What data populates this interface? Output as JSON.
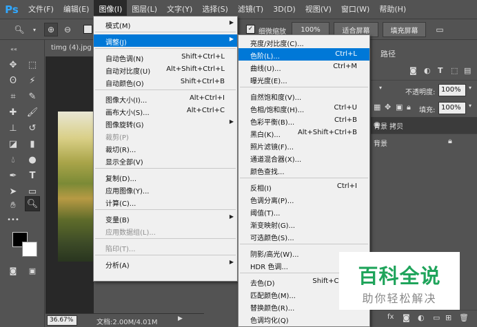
{
  "app": {
    "logo": "Ps"
  },
  "menubar": [
    "文件(F)",
    "编辑(E)",
    "图像(I)",
    "图层(L)",
    "文字(Y)",
    "选择(S)",
    "滤镜(T)",
    "3D(D)",
    "视图(V)",
    "窗口(W)",
    "帮助(H)"
  ],
  "options": {
    "resize_windows_label": "细微缩放",
    "zoom_value": "100%",
    "fit_screen": "适合屏幕",
    "fill_screen": "填充屏幕"
  },
  "document": {
    "tab": "timg (4).jpg",
    "zoom": "36.67%",
    "doc_info": "文档:2.00M/4.01M"
  },
  "image_menu": [
    {
      "label": "模式(M)",
      "submenu": true
    },
    {
      "sep": true
    },
    {
      "label": "调整(J)",
      "submenu": true,
      "highlight": true
    },
    {
      "sep": true
    },
    {
      "label": "自动色调(N)",
      "shortcut": "Shift+Ctrl+L"
    },
    {
      "label": "自动对比度(U)",
      "shortcut": "Alt+Shift+Ctrl+L"
    },
    {
      "label": "自动颜色(O)",
      "shortcut": "Shift+Ctrl+B"
    },
    {
      "sep": true
    },
    {
      "label": "图像大小(I)...",
      "shortcut": "Alt+Ctrl+I"
    },
    {
      "label": "画布大小(S)...",
      "shortcut": "Alt+Ctrl+C"
    },
    {
      "label": "图像旋转(G)",
      "submenu": true
    },
    {
      "label": "裁剪(P)",
      "disabled": true
    },
    {
      "label": "裁切(R)..."
    },
    {
      "label": "显示全部(V)"
    },
    {
      "sep": true
    },
    {
      "label": "复制(D)..."
    },
    {
      "label": "应用图像(Y)..."
    },
    {
      "label": "计算(C)..."
    },
    {
      "sep": true
    },
    {
      "label": "变量(B)",
      "submenu": true
    },
    {
      "label": "应用数据组(L)...",
      "disabled": true
    },
    {
      "sep": true
    },
    {
      "label": "陷印(T)...",
      "disabled": true
    },
    {
      "sep": true
    },
    {
      "label": "分析(A)",
      "submenu": true
    }
  ],
  "adjust_menu": [
    {
      "label": "亮度/对比度(C)..."
    },
    {
      "label": "色阶(L)...",
      "shortcut": "Ctrl+L",
      "highlight": true
    },
    {
      "label": "曲线(U)...",
      "shortcut": "Ctrl+M"
    },
    {
      "label": "曝光度(E)..."
    },
    {
      "sep": true
    },
    {
      "label": "自然饱和度(V)..."
    },
    {
      "label": "色相/饱和度(H)...",
      "shortcut": "Ctrl+U"
    },
    {
      "label": "色彩平衡(B)...",
      "shortcut": "Ctrl+B"
    },
    {
      "label": "黑白(K)...",
      "shortcut": "Alt+Shift+Ctrl+B"
    },
    {
      "label": "照片滤镜(F)..."
    },
    {
      "label": "通道混合器(X)..."
    },
    {
      "label": "颜色查找..."
    },
    {
      "sep": true
    },
    {
      "label": "反相(I)",
      "shortcut": "Ctrl+I"
    },
    {
      "label": "色调分离(P)..."
    },
    {
      "label": "阈值(T)..."
    },
    {
      "label": "渐变映射(G)..."
    },
    {
      "label": "可选颜色(S)..."
    },
    {
      "sep": true
    },
    {
      "label": "阴影/高光(W)..."
    },
    {
      "label": "HDR 色调..."
    },
    {
      "sep": true
    },
    {
      "label": "去色(D)",
      "shortcut": "Shift+Ctrl+U"
    },
    {
      "label": "匹配颜色(M)..."
    },
    {
      "label": "替换颜色(R)..."
    },
    {
      "label": "色调均化(Q)"
    }
  ],
  "panel": {
    "tab_paths": "路径",
    "opacity_label": "不透明度:",
    "opacity_value": "100%",
    "fill_label": "填充:",
    "fill_value": "100%",
    "layers": [
      {
        "name": "背景 拷贝"
      },
      {
        "name": "背景",
        "locked": true
      }
    ]
  },
  "watermark": {
    "title": "百科全说",
    "subtitle": "助你轻松解决"
  },
  "colors": {
    "menu_highlight": "#0078d7",
    "watermark_green": "#1fa45b",
    "ps_blue": "#31a8ff"
  }
}
